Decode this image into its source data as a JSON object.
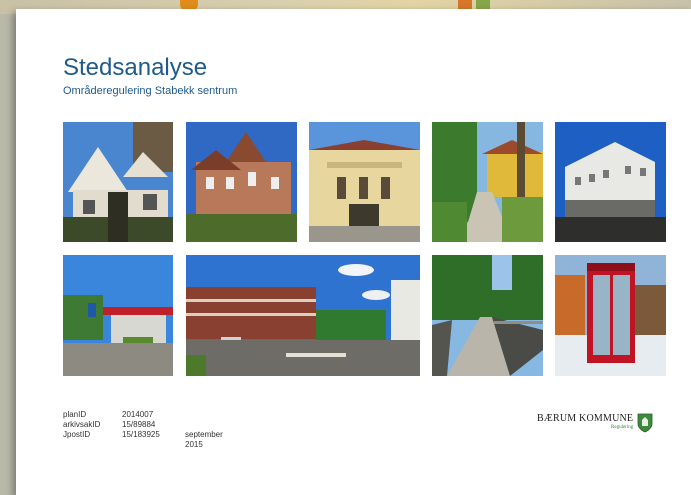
{
  "document": {
    "title": "Stedsanalyse",
    "subtitle": "Områderegulering Stabekk sentrum"
  },
  "photos": [
    {
      "name": "photo-white-villa"
    },
    {
      "name": "photo-brick-house"
    },
    {
      "name": "photo-yellow-station"
    },
    {
      "name": "photo-wooded-path"
    },
    {
      "name": "photo-white-building"
    },
    {
      "name": "photo-gas-station"
    },
    {
      "name": "photo-street-intersection"
    },
    {
      "name": "photo-bridge-path"
    },
    {
      "name": "photo-phone-booth"
    }
  ],
  "metadata": [
    {
      "key": "planID",
      "value": "2014007",
      "extra": ""
    },
    {
      "key": "arkivsakID",
      "value": "15/89884",
      "extra": ""
    },
    {
      "key": "JpostID",
      "value": "15/183925",
      "extra": "september 2015"
    }
  ],
  "logo": {
    "name": "BÆRUM KOMMUNE",
    "sub": "Regulering",
    "icon": "municipal-shield-icon",
    "color": "#3d8a3d"
  },
  "colors": {
    "title": "#1f5a8c",
    "background": "#b9b9a9"
  }
}
